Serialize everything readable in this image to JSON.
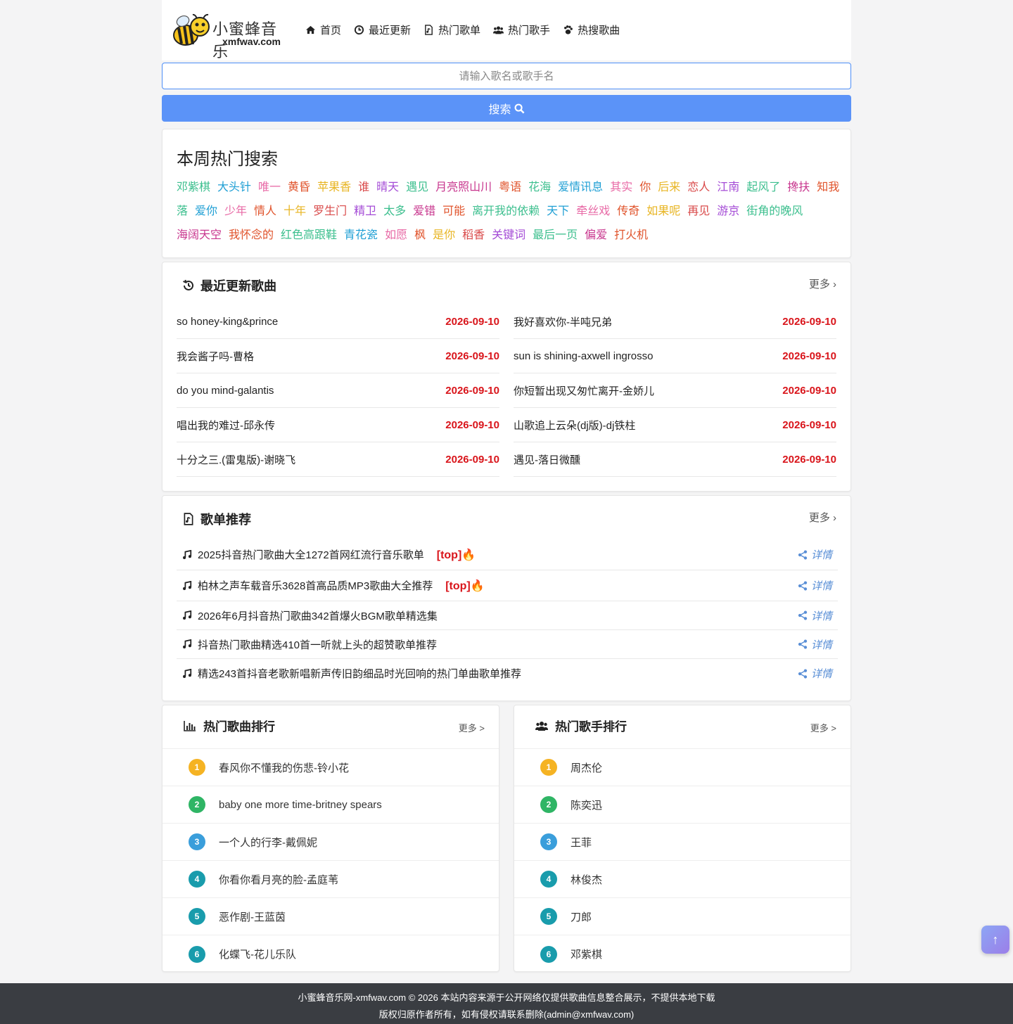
{
  "header": {
    "logo_cn": "小蜜蜂音乐",
    "logo_en": "xmfwav.com",
    "nav": [
      {
        "label": "首页",
        "icon": "home-icon"
      },
      {
        "label": "最近更新",
        "icon": "clock-icon"
      },
      {
        "label": "热门歌单",
        "icon": "file-audio-icon"
      },
      {
        "label": "热门歌手",
        "icon": "users-icon"
      },
      {
        "label": "热搜歌曲",
        "icon": "paw-icon"
      }
    ]
  },
  "search": {
    "placeholder": "请输入歌名或歌手名",
    "button_label": "搜索"
  },
  "hot_search": {
    "title": "本周热门搜索",
    "tags": [
      {
        "text": "邓紫棋",
        "color": "#3cbf8e"
      },
      {
        "text": "大头针",
        "color": "#1f9fd4"
      },
      {
        "text": "唯一",
        "color": "#e86aa6"
      },
      {
        "text": "黄昏",
        "color": "#e0532b"
      },
      {
        "text": "苹果香",
        "color": "#e8b523"
      },
      {
        "text": "谁",
        "color": "#d94a4a"
      },
      {
        "text": "晴天",
        "color": "#a44bd6"
      },
      {
        "text": "遇见",
        "color": "#3cbf8e"
      },
      {
        "text": "月亮照山川",
        "color": "#c8368e"
      },
      {
        "text": "粤语",
        "color": "#e0532b"
      },
      {
        "text": "花海",
        "color": "#3cbf8e"
      },
      {
        "text": "爱情讯息",
        "color": "#1f9fd4"
      },
      {
        "text": "其实",
        "color": "#e86aa6"
      },
      {
        "text": "你",
        "color": "#e0532b"
      },
      {
        "text": "后来",
        "color": "#e8b523"
      },
      {
        "text": "恋人",
        "color": "#d94a4a"
      },
      {
        "text": "江南",
        "color": "#a44bd6"
      },
      {
        "text": "起风了",
        "color": "#3cbf8e"
      },
      {
        "text": "搀扶",
        "color": "#c8368e"
      },
      {
        "text": "知我",
        "color": "#e0532b"
      },
      {
        "text": "落",
        "color": "#3cbf8e"
      },
      {
        "text": "爱你",
        "color": "#1f9fd4"
      },
      {
        "text": "少年",
        "color": "#e86aa6"
      },
      {
        "text": "情人",
        "color": "#e0532b"
      },
      {
        "text": "十年",
        "color": "#e8b523"
      },
      {
        "text": "罗生门",
        "color": "#d94a4a"
      },
      {
        "text": "精卫",
        "color": "#a44bd6"
      },
      {
        "text": "太多",
        "color": "#3cbf8e"
      },
      {
        "text": "爱错",
        "color": "#c8368e"
      },
      {
        "text": "可能",
        "color": "#e0532b"
      },
      {
        "text": "离开我的依赖",
        "color": "#3cbf8e"
      },
      {
        "text": "天下",
        "color": "#1f9fd4"
      },
      {
        "text": "牵丝戏",
        "color": "#e86aa6"
      },
      {
        "text": "传奇",
        "color": "#e0532b"
      },
      {
        "text": "如果呢",
        "color": "#e8b523"
      },
      {
        "text": "再见",
        "color": "#d94a4a"
      },
      {
        "text": "游京",
        "color": "#a44bd6"
      },
      {
        "text": "街角的晚风",
        "color": "#3cbf8e"
      },
      {
        "text": "海阔天空",
        "color": "#c8368e"
      },
      {
        "text": "我怀念的",
        "color": "#e0532b"
      },
      {
        "text": "红色高跟鞋",
        "color": "#3cbf8e"
      },
      {
        "text": "青花瓷",
        "color": "#1f9fd4"
      },
      {
        "text": "如愿",
        "color": "#e86aa6"
      },
      {
        "text": "枫",
        "color": "#e0532b"
      },
      {
        "text": "是你",
        "color": "#e8b523"
      },
      {
        "text": "稻香",
        "color": "#d94a4a"
      },
      {
        "text": "关键词",
        "color": "#a44bd6"
      },
      {
        "text": "最后一页",
        "color": "#3cbf8e"
      },
      {
        "text": "偏爱",
        "color": "#c8368e"
      },
      {
        "text": "打火机",
        "color": "#e0532b"
      }
    ]
  },
  "latest": {
    "title": "最近更新歌曲",
    "more": "更多",
    "songs": [
      {
        "name": "so honey-king&prince",
        "date": "2026-09-10"
      },
      {
        "name": "我好喜欢你-半吨兄弟",
        "date": "2026-09-10"
      },
      {
        "name": "我会酱子吗-曹格",
        "date": "2026-09-10"
      },
      {
        "name": "sun is shining-axwell ingrosso",
        "date": "2026-09-10"
      },
      {
        "name": "do you mind-galantis",
        "date": "2026-09-10"
      },
      {
        "name": "你短暂出现又匆忙离开-金娇儿",
        "date": "2026-09-10"
      },
      {
        "name": "唱出我的难过-邱永传",
        "date": "2026-09-10"
      },
      {
        "name": "山歌追上云朵(dj版)-dj铁柱",
        "date": "2026-09-10"
      },
      {
        "name": "十分之三.(雷鬼版)-谢晓飞",
        "date": "2026-09-10"
      },
      {
        "name": "遇见-落日微醺",
        "date": "2026-09-10"
      }
    ]
  },
  "playlists": {
    "title": "歌单推荐",
    "more": "更多",
    "detail_label": "详情",
    "items": [
      {
        "title": "2025抖音热门歌曲大全1272首网红流行音乐歌单",
        "badge": "[top]🔥"
      },
      {
        "title": "柏林之声车载音乐3628首高品质MP3歌曲大全推荐",
        "badge": "[top]🔥"
      },
      {
        "title": "2026年6月抖音热门歌曲342首爆火BGM歌单精选集",
        "badge": ""
      },
      {
        "title": "抖音热门歌曲精选410首一听就上头的超赞歌单推荐",
        "badge": ""
      },
      {
        "title": "精选243首抖音老歌新唱新声传旧韵细品时光回响的热门单曲歌单推荐",
        "badge": ""
      }
    ]
  },
  "song_rank": {
    "title": "热门歌曲排行",
    "more": "更多 >",
    "items": [
      {
        "num": "1",
        "name": "春风你不懂我的伤悲-铃小花",
        "color": "#f5b323"
      },
      {
        "num": "2",
        "name": "baby one more time-britney spears",
        "color": "#2fb565"
      },
      {
        "num": "3",
        "name": "一个人的行李-戴佩妮",
        "color": "#3a9edb"
      },
      {
        "num": "4",
        "name": "你看你看月亮的脸-孟庭苇",
        "color": "#199cac"
      },
      {
        "num": "5",
        "name": "恶作剧-王蓝茵",
        "color": "#199cac"
      },
      {
        "num": "6",
        "name": "化蝶飞-花儿乐队",
        "color": "#199cac"
      }
    ]
  },
  "singer_rank": {
    "title": "热门歌手排行",
    "more": "更多 >",
    "items": [
      {
        "num": "1",
        "name": "周杰伦",
        "color": "#f5b323"
      },
      {
        "num": "2",
        "name": "陈奕迅",
        "color": "#2fb565"
      },
      {
        "num": "3",
        "name": "王菲",
        "color": "#3a9edb"
      },
      {
        "num": "4",
        "name": "林俊杰",
        "color": "#199cac"
      },
      {
        "num": "5",
        "name": "刀郎",
        "color": "#199cac"
      },
      {
        "num": "6",
        "name": "邓紫棋",
        "color": "#199cac"
      }
    ]
  },
  "footer": {
    "line1": "小蜜蜂音乐网-xmfwav.com © 2026 本站内容来源于公开网络仅提供歌曲信息整合展示，不提供本地下载",
    "line2": "版权归原作者所有，如有侵权请联系删除(admin@xmfwav.com)"
  },
  "back_to_top": "↑"
}
